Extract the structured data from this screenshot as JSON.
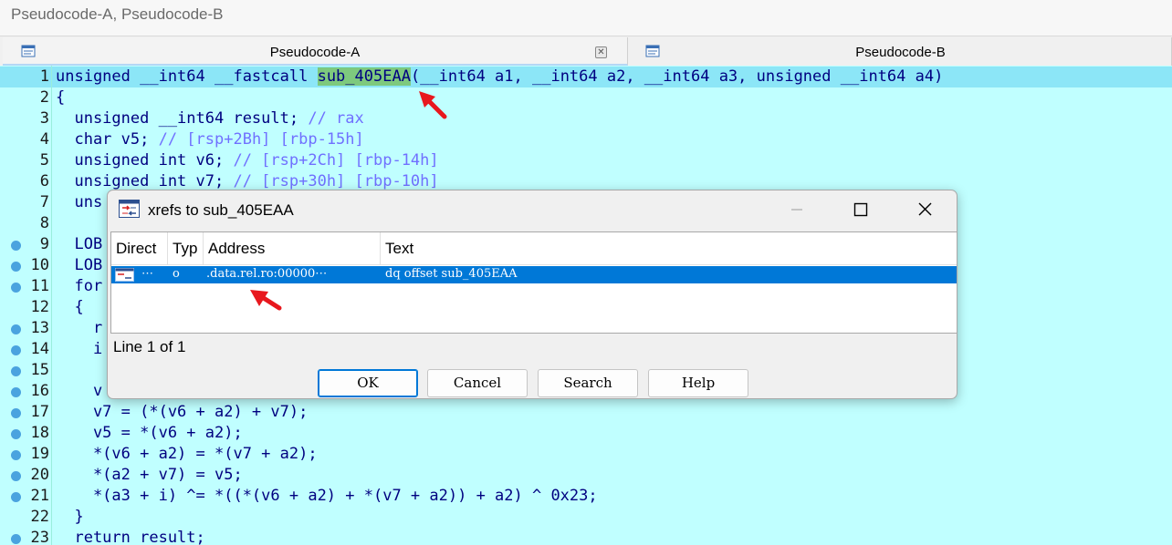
{
  "window": {
    "title": "Pseudocode-A, Pseudocode-B"
  },
  "tabs": [
    {
      "label": "Pseudocode-A",
      "icon": "document-icon",
      "has_close": true
    },
    {
      "label": "Pseudocode-B",
      "icon": "document-icon",
      "has_close": false
    }
  ],
  "code": {
    "lines": [
      {
        "n": "1",
        "text": "unsigned __int64 __fastcall sub_405EAA(__int64 a1, __int64 a2, __int64 a3, unsigned __int64 a4)",
        "highlight": true
      },
      {
        "n": "2",
        "text": "{"
      },
      {
        "n": "3",
        "text": "  unsigned __int64 result; // rax"
      },
      {
        "n": "4",
        "text": "  char v5; // [rsp+2Bh] [rbp-15h]"
      },
      {
        "n": "5",
        "text": "  unsigned int v6; // [rsp+2Ch] [rbp-14h]"
      },
      {
        "n": "6",
        "text": "  unsigned int v7; // [rsp+30h] [rbp-10h]"
      },
      {
        "n": "7",
        "text": "  uns"
      },
      {
        "n": "8",
        "text": ""
      },
      {
        "n": "9",
        "text": "  LOB",
        "bp": true
      },
      {
        "n": "10",
        "text": "  LOB",
        "bp": true
      },
      {
        "n": "11",
        "text": "  for",
        "bp": true
      },
      {
        "n": "12",
        "text": "  {"
      },
      {
        "n": "13",
        "text": "    r",
        "bp": true
      },
      {
        "n": "14",
        "text": "    i",
        "bp": true
      },
      {
        "n": "15",
        "text": "",
        "bp": true
      },
      {
        "n": "16",
        "text": "    v",
        "bp": true
      },
      {
        "n": "17",
        "text": "    v7 = (*(v6 + a2) + v7);",
        "bp": true
      },
      {
        "n": "18",
        "text": "    v5 = *(v6 + a2);",
        "bp": true
      },
      {
        "n": "19",
        "text": "    *(v6 + a2) = *(v7 + a2);",
        "bp": true
      },
      {
        "n": "20",
        "text": "    *(a2 + v7) = v5;",
        "bp": true
      },
      {
        "n": "21",
        "text": "    *(a3 + i) ^= *((*(v6 + a2) + *(v7 + a2)) + a2) ^ 0x23;",
        "bp": true
      },
      {
        "n": "22",
        "text": "  }"
      },
      {
        "n": "23",
        "text": "  return result;",
        "bp": true
      }
    ]
  },
  "dialog": {
    "title": "xrefs to sub_405EAA",
    "columns": [
      "Direct",
      "Typ",
      "Address",
      "Text"
    ],
    "rows": [
      {
        "direct": "⋯",
        "type": "o",
        "address": ".data.rel.ro:00000⋯",
        "text": "dq offset sub_405EAA"
      }
    ],
    "status": "Line 1 of 1",
    "buttons": {
      "ok": "OK",
      "cancel": "Cancel",
      "search": "Search",
      "help": "Help"
    }
  },
  "colors": {
    "code_bg": "#c0ffff",
    "line_highlight": "#8ce6f7",
    "selection": "#0078d7",
    "annotation_arrow": "#e8181e"
  }
}
